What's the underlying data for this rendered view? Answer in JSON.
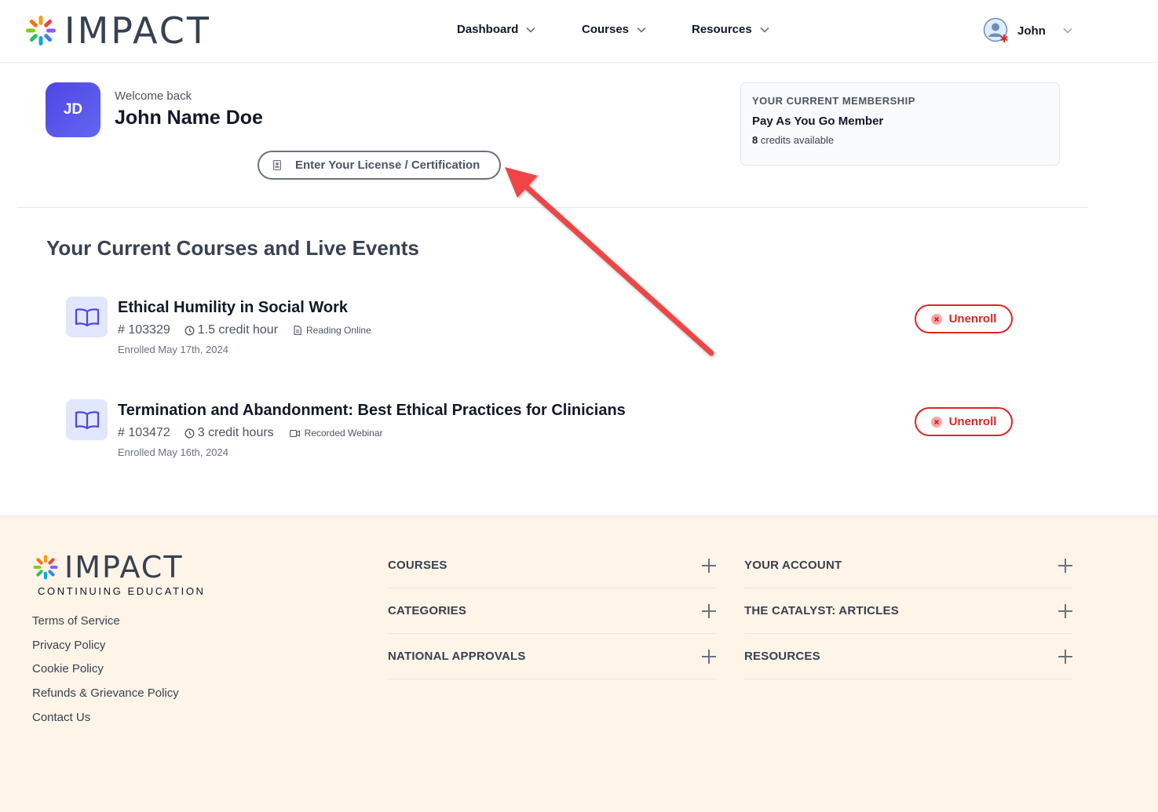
{
  "brand": {
    "name": "IMPACT",
    "footer_sub": "CONTINUING EDUCATION"
  },
  "nav": {
    "items": [
      {
        "label": "Dashboard"
      },
      {
        "label": "Courses"
      },
      {
        "label": "Resources"
      }
    ],
    "user": {
      "label": "John"
    }
  },
  "welcome": {
    "initials": "JD",
    "greeting": "Welcome back",
    "name": "John Name Doe",
    "license_button": "Enter Your License / Certification"
  },
  "membership": {
    "heading": "YOUR CURRENT MEMBERSHIP",
    "plan": "Pay As You Go Member",
    "credits_count": "8",
    "credits_text": "credits available"
  },
  "courses_section": {
    "title": "Your Current Courses and Live Events",
    "courses": [
      {
        "title": "Ethical Humility in Social Work",
        "id": "# 103329",
        "credits": "1.5 credit hour",
        "format": "Reading Online",
        "format_icon": "document-icon",
        "enrolled": "Enrolled May 17th, 2024",
        "action": "Unenroll"
      },
      {
        "title": "Termination and Abandonment: Best Ethical Practices for Clinicians",
        "id": "# 103472",
        "credits": "3 credit hours",
        "format": "Recorded Webinar",
        "format_icon": "video-icon",
        "enrolled": "Enrolled May 16th, 2024",
        "action": "Unenroll"
      }
    ]
  },
  "footer": {
    "links": [
      "Terms of Service",
      "Privacy Policy",
      "Cookie Policy",
      "Refunds & Grievance Policy",
      "Contact Us"
    ],
    "accordions_left": [
      "COURSES",
      "CATEGORIES",
      "NATIONAL APPROVALS"
    ],
    "accordions_right": [
      "YOUR ACCOUNT",
      "THE CATALYST: ARTICLES",
      "RESOURCES"
    ]
  },
  "colors": {
    "accent": "#4f46e5",
    "danger": "#dc2626",
    "arrow": "#ef4444",
    "footer_bg": "#fff4e8"
  }
}
